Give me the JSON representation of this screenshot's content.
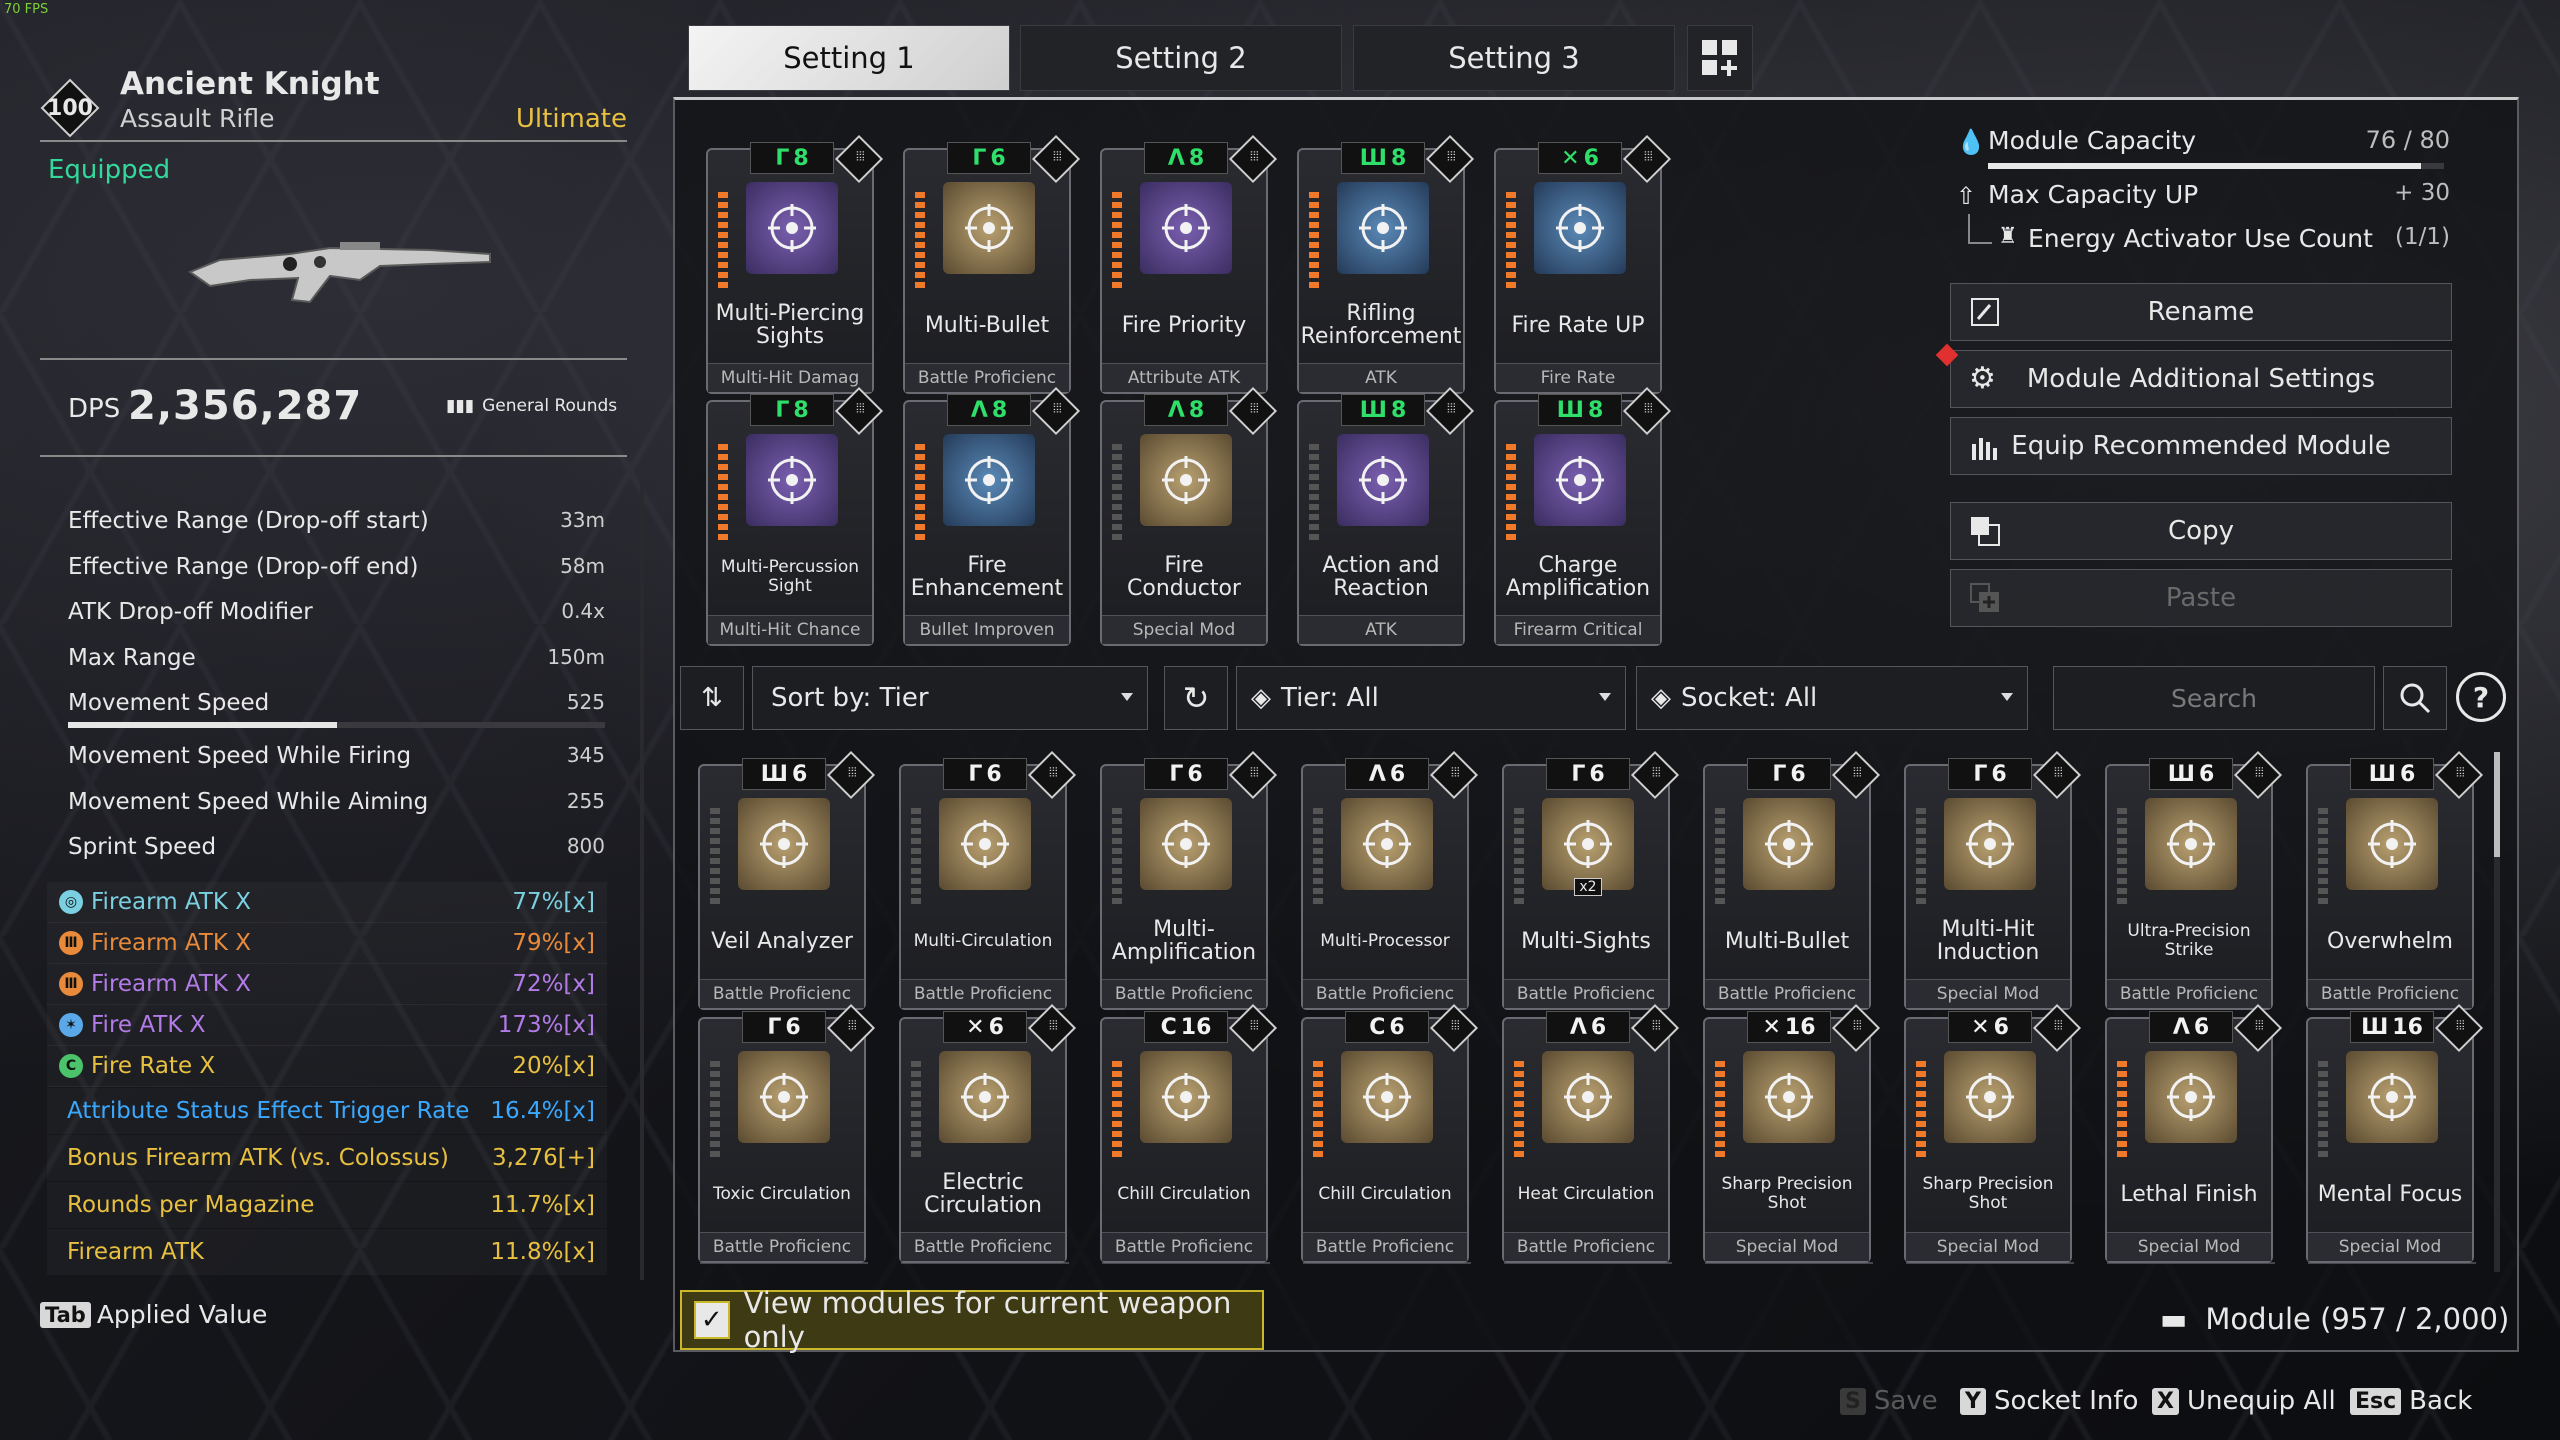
{
  "fps": "70 FPS",
  "weapon": {
    "level": "100",
    "name": "Ancient Knight",
    "type": "Assault Rifle",
    "rarity": "Ultimate",
    "status": "Equipped",
    "dps_label": "DPS",
    "dps_value": "2,356,287",
    "ammo": "General Rounds"
  },
  "stats": [
    {
      "label": "Effective Range (Drop-off start)",
      "value": "33m"
    },
    {
      "label": "Effective Range (Drop-off end)",
      "value": "58m"
    },
    {
      "label": "ATK Drop-off Modifier",
      "value": "0.4x"
    },
    {
      "label": "Max Range",
      "value": "150m"
    },
    {
      "label": "Movement Speed",
      "value": "525"
    },
    {
      "label": "Movement Speed While Firing",
      "value": "345"
    },
    {
      "label": "Movement Speed While Aiming",
      "value": "255"
    },
    {
      "label": "Sprint Speed",
      "value": "800"
    }
  ],
  "movement_speed_bar": 0.5,
  "effects": [
    {
      "label": "Firearm ATK X",
      "value": "77%[x]",
      "color": "#7ad0e0",
      "icon": "cyan-circle-icon",
      "glyph": "◎"
    },
    {
      "label": "Firearm ATK X",
      "value": "79%[x]",
      "color": "#e88a3a",
      "icon": "orange-bars-icon",
      "glyph": "Ⅲ"
    },
    {
      "label": "Firearm ATK X",
      "value": "72%[x]",
      "color": "#b27be8",
      "icon": "orange-bars-icon",
      "glyph": "Ⅲ"
    },
    {
      "label": "Fire ATK X",
      "value": "173%[x]",
      "color": "#b27be8",
      "icon": "blue-star-icon",
      "glyph": "✶"
    },
    {
      "label": "Fire Rate X",
      "value": "20%[x]",
      "color": "#e8c040",
      "icon": "green-c-icon",
      "glyph": "C"
    }
  ],
  "bonuses": [
    {
      "label": "Attribute Status Effect Trigger Rate",
      "value": "16.4%[x]",
      "color": "#3aa8ff"
    },
    {
      "label": "Bonus Firearm ATK (vs. Colossus)",
      "value": "3,276[+]",
      "color": "#e8c040"
    },
    {
      "label": "Rounds per Magazine",
      "value": "11.7%[x]",
      "color": "#e8c040"
    },
    {
      "label": "Firearm ATK",
      "value": "11.8%[x]",
      "color": "#e8c040"
    }
  ],
  "applied_key": "Tab",
  "applied_label": "Applied Value",
  "tabs": [
    "Setting 1",
    "Setting 2",
    "Setting 3"
  ],
  "equipped_modules": [
    {
      "tier": "Γ",
      "cost": "8",
      "name": "Multi-Piercing Sights",
      "cat": "Multi-Hit Damag",
      "art": "p",
      "stripe": "o",
      "green": true
    },
    {
      "tier": "Γ",
      "cost": "6",
      "name": "Multi-Bullet",
      "cat": "Battle Proficienc",
      "art": "g",
      "stripe": "o",
      "green": true
    },
    {
      "tier": "Λ",
      "cost": "8",
      "name": "Fire Priority",
      "cat": "Attribute ATK",
      "art": "p",
      "stripe": "o",
      "green": true
    },
    {
      "tier": "Ш",
      "cost": "8",
      "name": "Rifling Reinforcement",
      "cat": "ATK",
      "art": "b",
      "stripe": "o",
      "green": true
    },
    {
      "tier": "✕",
      "cost": "6",
      "name": "Fire Rate UP",
      "cat": "Fire Rate",
      "art": "b",
      "stripe": "o",
      "green": true
    },
    {
      "tier": "Γ",
      "cost": "8",
      "name": "Multi-Percussion Sight",
      "cat": "Multi-Hit Chance",
      "art": "p",
      "stripe": "o",
      "green": true,
      "small": true
    },
    {
      "tier": "Λ",
      "cost": "8",
      "name": "Fire Enhancement",
      "cat": "Bullet Improven",
      "art": "b",
      "stripe": "o",
      "green": true
    },
    {
      "tier": "Λ",
      "cost": "8",
      "name": "Fire Conductor",
      "cat": "Special Mod",
      "art": "g",
      "stripe": "",
      "green": true
    },
    {
      "tier": "Ш",
      "cost": "8",
      "name": "Action and Reaction",
      "cat": "ATK",
      "art": "p",
      "stripe": "",
      "green": true
    },
    {
      "tier": "Ш",
      "cost": "8",
      "name": "Charge Amplification",
      "cat": "Firearm Critical",
      "art": "p",
      "stripe": "o",
      "green": true
    }
  ],
  "capacity": {
    "label": "Module Capacity",
    "value": "76 / 80",
    "fill": 0.95,
    "max_label": "Max Capacity UP",
    "max_value": "+ 30",
    "energy_label": "Energy Activator Use Count",
    "energy_value": "(1/1)"
  },
  "actions": {
    "rename": "Rename",
    "additional": "Module Additional Settings",
    "recommended": "Equip Recommended Module",
    "copy": "Copy",
    "paste": "Paste"
  },
  "filters": {
    "sort": "Sort by: Tier",
    "tier": "Tier: All",
    "socket": "Socket: All",
    "search_placeholder": "Search"
  },
  "inventory": [
    {
      "tier": "Ш",
      "cost": "6",
      "name": "Veil Analyzer",
      "cat": "Battle Proficienc"
    },
    {
      "tier": "Γ",
      "cost": "6",
      "name": "Multi-Circulation",
      "cat": "Battle Proficienc",
      "small": true
    },
    {
      "tier": "Γ",
      "cost": "6",
      "name": "Multi-Amplification",
      "cat": "Battle Proficienc"
    },
    {
      "tier": "Λ",
      "cost": "6",
      "name": "Multi-Processor",
      "cat": "Battle Proficienc",
      "small": true
    },
    {
      "tier": "Γ",
      "cost": "6",
      "name": "Multi-Sights",
      "cat": "Battle Proficienc",
      "badge": "x2"
    },
    {
      "tier": "Γ",
      "cost": "6",
      "name": "Multi-Bullet",
      "cat": "Battle Proficienc"
    },
    {
      "tier": "Γ",
      "cost": "6",
      "name": "Multi-Hit Induction",
      "cat": "Special Mod"
    },
    {
      "tier": "Ш",
      "cost": "6",
      "name": "Ultra-Precision Strike",
      "cat": "Battle Proficienc",
      "small": true
    },
    {
      "tier": "Ш",
      "cost": "6",
      "name": "Overwhelm",
      "cat": "Battle Proficienc"
    },
    {
      "tier": "Γ",
      "cost": "6",
      "name": "Toxic Circulation",
      "cat": "Battle Proficienc",
      "small": true
    },
    {
      "tier": "✕",
      "cost": "6",
      "name": "Electric Circulation",
      "cat": "Battle Proficienc"
    },
    {
      "tier": "C",
      "cost": "16",
      "name": "Chill Circulation",
      "cat": "Battle Proficienc",
      "small": true
    },
    {
      "tier": "C",
      "cost": "6",
      "name": "Chill Circulation",
      "cat": "Battle Proficienc",
      "small": true
    },
    {
      "tier": "Λ",
      "cost": "6",
      "name": "Heat Circulation",
      "cat": "Battle Proficienc",
      "small": true
    },
    {
      "tier": "✕",
      "cost": "16",
      "name": "Sharp Precision Shot",
      "cat": "Special Mod",
      "small": true
    },
    {
      "tier": "✕",
      "cost": "6",
      "name": "Sharp Precision Shot",
      "cat": "Special Mod",
      "small": true
    },
    {
      "tier": "Λ",
      "cost": "6",
      "name": "Lethal Finish",
      "cat": "Special Mod"
    },
    {
      "tier": "Ш",
      "cost": "16",
      "name": "Mental Focus",
      "cat": "Special Mod"
    }
  ],
  "view_current_only": "View modules for current weapon only",
  "module_count": "Module (957 / 2,000)",
  "hints": [
    {
      "key": "S",
      "label": "Save",
      "disabled": true
    },
    {
      "key": "Y",
      "label": "Socket Info"
    },
    {
      "key": "X",
      "label": "Unequip All"
    },
    {
      "key": "Esc",
      "label": "Back"
    }
  ]
}
